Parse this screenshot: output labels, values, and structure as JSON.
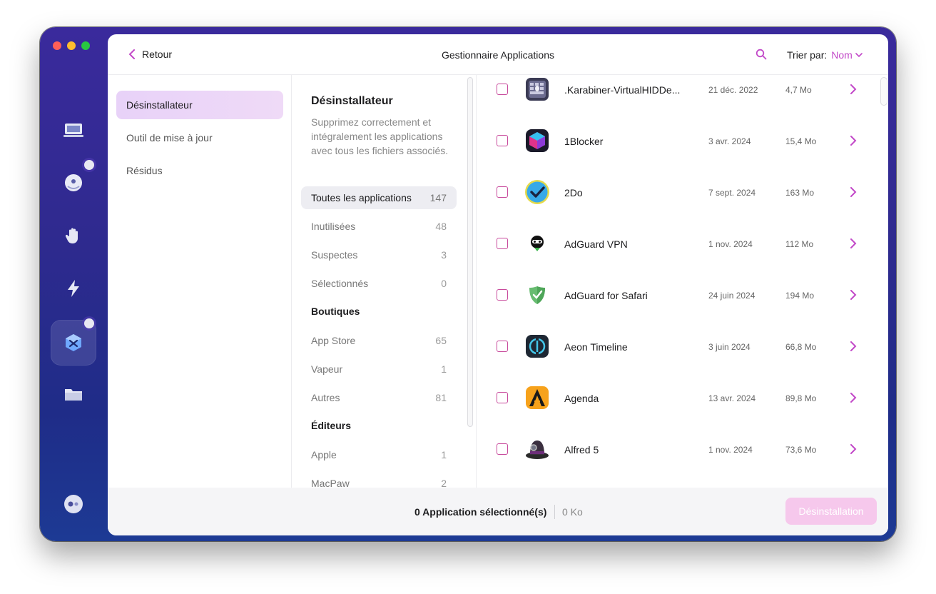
{
  "header": {
    "back_label": "Retour",
    "title": "Gestionnaire Applications",
    "sort_label": "Trier par:",
    "sort_value": "Nom"
  },
  "sidebar": {
    "items": [
      {
        "label": "Désinstallateur",
        "active": true
      },
      {
        "label": "Outil de mise à jour",
        "active": false
      },
      {
        "label": "Résidus",
        "active": false
      }
    ]
  },
  "filters": {
    "heading": "Désinstallateur",
    "description": "Supprimez correctement et intégralement les applications avec tous les fichiers associés.",
    "groups": [
      {
        "label": "Toutes les applications",
        "count": "147",
        "active": true
      },
      {
        "label": "Inutilisées",
        "count": "48"
      },
      {
        "label": "Suspectes",
        "count": "3"
      },
      {
        "label": "Sélectionnés",
        "count": "0"
      }
    ],
    "stores_title": "Boutiques",
    "stores": [
      {
        "label": "App Store",
        "count": "65"
      },
      {
        "label": "Vapeur",
        "count": "1"
      },
      {
        "label": "Autres",
        "count": "81"
      }
    ],
    "vendors_title": "Éditeurs",
    "vendors": [
      {
        "label": "Apple",
        "count": "1"
      },
      {
        "label": "MacPaw",
        "count": "2"
      }
    ]
  },
  "apps": [
    {
      "name": ".Karabiner-VirtualHIDDe...",
      "date": "21 déc. 2022",
      "size": "4,7 Mo",
      "icon": "karabiner-icon"
    },
    {
      "name": "1Blocker",
      "date": "3 avr. 2024",
      "size": "15,4 Mo",
      "icon": "1blocker-icon"
    },
    {
      "name": "2Do",
      "date": "7 sept. 2024",
      "size": "163 Mo",
      "icon": "2do-icon"
    },
    {
      "name": "AdGuard VPN",
      "date": "1 nov. 2024",
      "size": "112 Mo",
      "icon": "adguard-vpn-icon"
    },
    {
      "name": "AdGuard for Safari",
      "date": "24 juin 2024",
      "size": "194 Mo",
      "icon": "adguard-safari-icon"
    },
    {
      "name": "Aeon Timeline",
      "date": "3 juin 2024",
      "size": "66,8 Mo",
      "icon": "aeon-timeline-icon"
    },
    {
      "name": "Agenda",
      "date": "13 avr. 2024",
      "size": "89,8 Mo",
      "icon": "agenda-icon"
    },
    {
      "name": "Alfred 5",
      "date": "1 nov. 2024",
      "size": "73,6 Mo",
      "icon": "alfred-icon"
    }
  ],
  "footer": {
    "selected_text": "0 Application sélectionné(s)",
    "selected_size": "0 Ko",
    "uninstall_label": "Désinstallation"
  },
  "colors": {
    "accent": "#c248c8",
    "checkbox": "#c84a9c",
    "rail_bg": "#2f2a8f"
  }
}
